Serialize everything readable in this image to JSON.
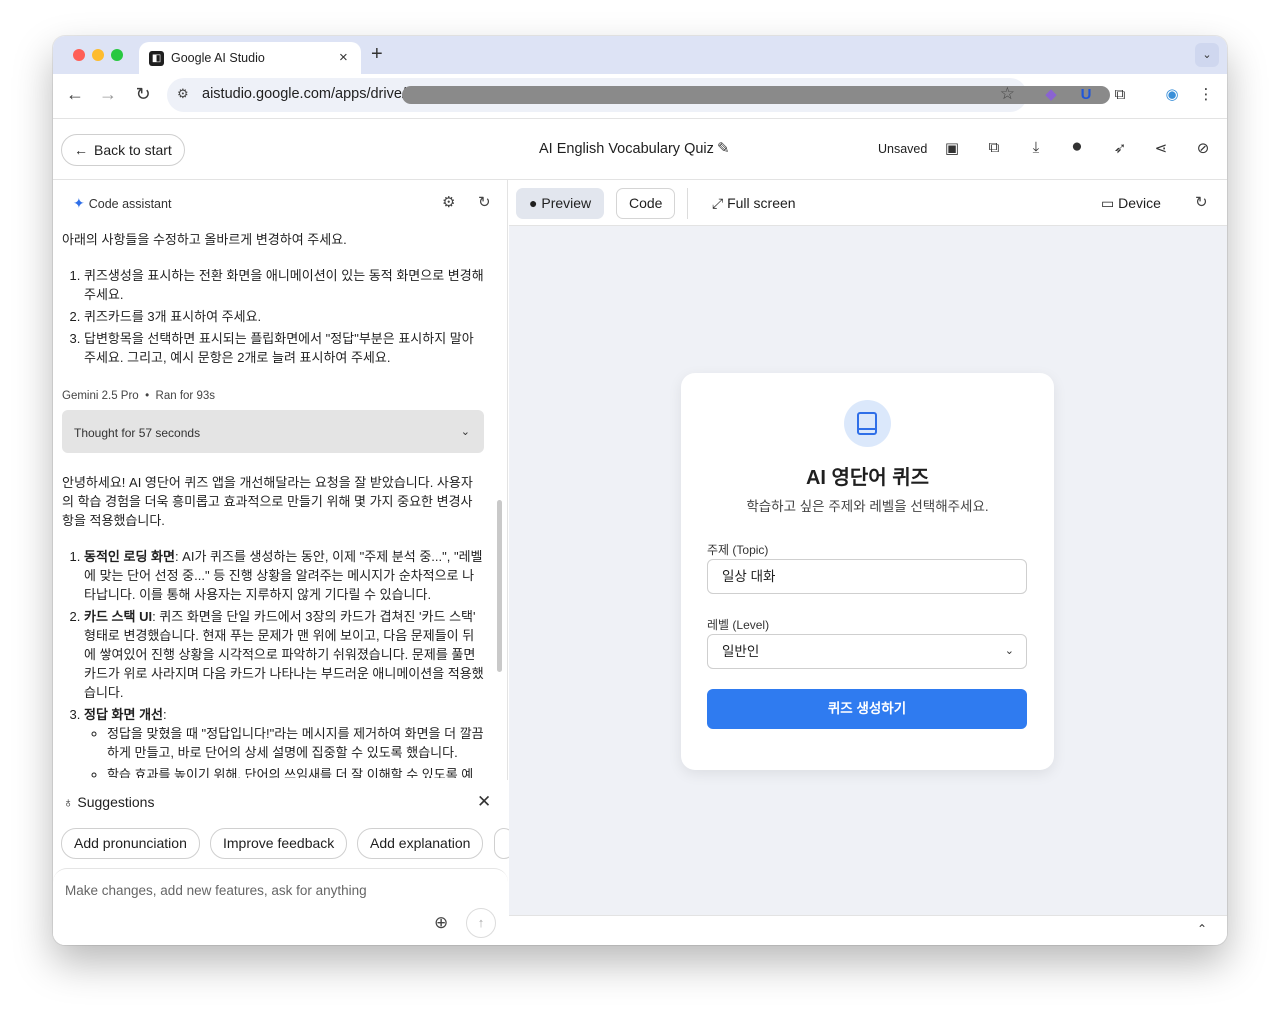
{
  "browser": {
    "tab_title": "Google AI Studio",
    "tab_close": "×",
    "new_tab": "+",
    "url_visible": "aistudio.google.com/apps/drive/",
    "url_tail_redacted": true
  },
  "header": {
    "back_label": "Back to start",
    "project_title": "AI English Vocabulary Quiz",
    "status": "Unsaved"
  },
  "assistant": {
    "title": "Code assistant",
    "user_message": {
      "intro": "아래의 사항들을 수정하고 올바르게 변경하여 주세요.",
      "items": [
        "퀴즈생성을 표시하는 전환 화면을 애니메이션이 있는 동적 화면으로 변경해 주세요.",
        "퀴즈카드를 3개 표시하여 주세요.",
        "답변항목을 선택하면 표시되는 플립화면에서 \"정답\"부분은 표시하지 말아 주세요. 그리고, 예시 문항은 2개로 늘려 표시하여 주세요."
      ]
    },
    "model": "Gemini 2.5 Pro",
    "run_time": "Ran for 93s",
    "thought_label": "Thought for 57 seconds",
    "response_intro": "안녕하세요! AI 영단어 퀴즈 앱을 개선해달라는 요청을 잘 받았습니다. 사용자의 학습 경험을 더욱 흥미롭고 효과적으로 만들기 위해 몇 가지 중요한 변경사항을 적용했습니다.",
    "response_items": [
      {
        "title": "동적인 로딩 화면",
        "text": ": AI가 퀴즈를 생성하는 동안, 이제 \"주제 분석 중...\", \"레벨에 맞는 단어 선정 중...\" 등 진행 상황을 알려주는 메시지가 순차적으로 나타납니다. 이를 통해 사용자는 지루하지 않게 기다릴 수 있습니다."
      },
      {
        "title": "카드 스택 UI",
        "text": ": 퀴즈 화면을 단일 카드에서 3장의 카드가 겹쳐진 '카드 스택' 형태로 변경했습니다. 현재 푸는 문제가 맨 위에 보이고, 다음 문제들이 뒤에 쌓여있어 진행 상황을 시각적으로 파악하기 쉬워졌습니다. 문제를 풀면 카드가 위로 사라지며 다음 카드가 나타나는 부드러운 애니메이션을 적용했습니다."
      },
      {
        "title": "정답 화면 개선",
        "text": ":"
      }
    ],
    "sub_items": [
      "정답을 맞혔을 때 \"정답입니다!\"라는 메시지를 제거하여 화면을 더 깔끔하게 만들고, 바로 단어의 상세 설명에 집중할 수 있도록 했습니다.",
      "학습 효과를 높이기 위해, 단어의 쓰임새를 더 잘 이해할 수 있도록 예문"
    ]
  },
  "suggestions": {
    "title": "Suggestions",
    "chips": [
      "Add pronunciation",
      "Improve feedback",
      "Add explanation"
    ]
  },
  "input": {
    "placeholder": "Make changes, add new features, ask for anything"
  },
  "preview_toolbar": {
    "preview": "Preview",
    "code": "Code",
    "fullscreen": "Full screen",
    "device": "Device"
  },
  "quiz_app": {
    "title": "AI 영단어 퀴즈",
    "subtitle": "학습하고 싶은 주제와 레벨을 선택해주세요.",
    "topic_label": "주제 (Topic)",
    "topic_value": "일상 대화",
    "level_label": "레벨 (Level)",
    "level_value": "일반인",
    "generate_button": "퀴즈 생성하기",
    "accent_color": "#2f7bf0"
  }
}
